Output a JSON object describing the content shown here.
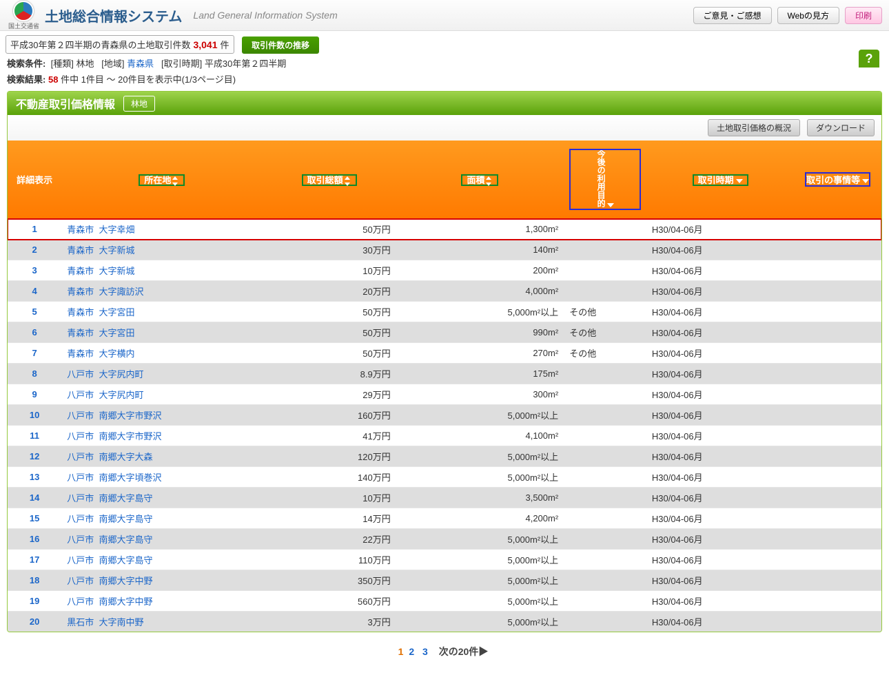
{
  "header": {
    "ministry": "国土交通省",
    "title_jp": "土地総合情報システム",
    "title_en": "Land General Information System",
    "buttons": {
      "feedback": "ご意見・ご感想",
      "howto": "Webの見方",
      "print": "印刷"
    }
  },
  "summary": {
    "period_prefix": "平成30年第２四半期の青森県の土地取引件数",
    "count": "3,041",
    "count_suffix": "件",
    "trend_btn": "取引件数の推移"
  },
  "conditions": {
    "label": "検索条件:",
    "type_lbl": "[種類]",
    "type_val": "林地",
    "region_lbl": "[地域]",
    "region_val": "青森県",
    "period_lbl": "[取引時期]",
    "period_val": "平成30年第２四半期"
  },
  "results": {
    "label": "検索結果:",
    "count": "58",
    "text": "件中 1件目 ～ 20件目を表示中(1/3ページ目)"
  },
  "section": {
    "title": "不動産取引価格情報",
    "badge": "林地",
    "help": "?"
  },
  "actions": {
    "overview": "土地取引価格の概況",
    "download": "ダウンロード"
  },
  "columns": {
    "detail": "詳細表示",
    "location": "所在地",
    "price": "取引総額",
    "area": "面積",
    "purpose": "今後の利用目的",
    "period": "取引時期",
    "circ": "取引の事情等"
  },
  "rows": [
    {
      "n": "1",
      "city": "青森市",
      "addr": "大字幸畑",
      "price": "50万円",
      "area": "1,300m²",
      "purpose": "",
      "period": "H30/04-06月",
      "hl": true
    },
    {
      "n": "2",
      "city": "青森市",
      "addr": "大字新城",
      "price": "30万円",
      "area": "140m²",
      "purpose": "",
      "period": "H30/04-06月"
    },
    {
      "n": "3",
      "city": "青森市",
      "addr": "大字新城",
      "price": "10万円",
      "area": "200m²",
      "purpose": "",
      "period": "H30/04-06月"
    },
    {
      "n": "4",
      "city": "青森市",
      "addr": "大字諏訪沢",
      "price": "20万円",
      "area": "4,000m²",
      "purpose": "",
      "period": "H30/04-06月"
    },
    {
      "n": "5",
      "city": "青森市",
      "addr": "大字宮田",
      "price": "50万円",
      "area": "5,000m²以上",
      "purpose": "その他",
      "period": "H30/04-06月"
    },
    {
      "n": "6",
      "city": "青森市",
      "addr": "大字宮田",
      "price": "50万円",
      "area": "990m²",
      "purpose": "その他",
      "period": "H30/04-06月"
    },
    {
      "n": "7",
      "city": "青森市",
      "addr": "大字横内",
      "price": "50万円",
      "area": "270m²",
      "purpose": "その他",
      "period": "H30/04-06月"
    },
    {
      "n": "8",
      "city": "八戸市",
      "addr": "大字尻内町",
      "price": "8.9万円",
      "area": "175m²",
      "purpose": "",
      "period": "H30/04-06月"
    },
    {
      "n": "9",
      "city": "八戸市",
      "addr": "大字尻内町",
      "price": "29万円",
      "area": "300m²",
      "purpose": "",
      "period": "H30/04-06月"
    },
    {
      "n": "10",
      "city": "八戸市",
      "addr": "南郷大字市野沢",
      "price": "160万円",
      "area": "5,000m²以上",
      "purpose": "",
      "period": "H30/04-06月"
    },
    {
      "n": "11",
      "city": "八戸市",
      "addr": "南郷大字市野沢",
      "price": "41万円",
      "area": "4,100m²",
      "purpose": "",
      "period": "H30/04-06月"
    },
    {
      "n": "12",
      "city": "八戸市",
      "addr": "南郷大字大森",
      "price": "120万円",
      "area": "5,000m²以上",
      "purpose": "",
      "period": "H30/04-06月"
    },
    {
      "n": "13",
      "city": "八戸市",
      "addr": "南郷大字頃巻沢",
      "price": "140万円",
      "area": "5,000m²以上",
      "purpose": "",
      "period": "H30/04-06月"
    },
    {
      "n": "14",
      "city": "八戸市",
      "addr": "南郷大字島守",
      "price": "10万円",
      "area": "3,500m²",
      "purpose": "",
      "period": "H30/04-06月"
    },
    {
      "n": "15",
      "city": "八戸市",
      "addr": "南郷大字島守",
      "price": "14万円",
      "area": "4,200m²",
      "purpose": "",
      "period": "H30/04-06月"
    },
    {
      "n": "16",
      "city": "八戸市",
      "addr": "南郷大字島守",
      "price": "22万円",
      "area": "5,000m²以上",
      "purpose": "",
      "period": "H30/04-06月"
    },
    {
      "n": "17",
      "city": "八戸市",
      "addr": "南郷大字島守",
      "price": "110万円",
      "area": "5,000m²以上",
      "purpose": "",
      "period": "H30/04-06月"
    },
    {
      "n": "18",
      "city": "八戸市",
      "addr": "南郷大字中野",
      "price": "350万円",
      "area": "5,000m²以上",
      "purpose": "",
      "period": "H30/04-06月"
    },
    {
      "n": "19",
      "city": "八戸市",
      "addr": "南郷大字中野",
      "price": "560万円",
      "area": "5,000m²以上",
      "purpose": "",
      "period": "H30/04-06月"
    },
    {
      "n": "20",
      "city": "黒石市",
      "addr": "大字南中野",
      "price": "3万円",
      "area": "5,000m²以上",
      "purpose": "",
      "period": "H30/04-06月"
    }
  ],
  "pager": {
    "p1": "1",
    "p2": "2",
    "p3": "3",
    "next": "次の20件▶"
  }
}
